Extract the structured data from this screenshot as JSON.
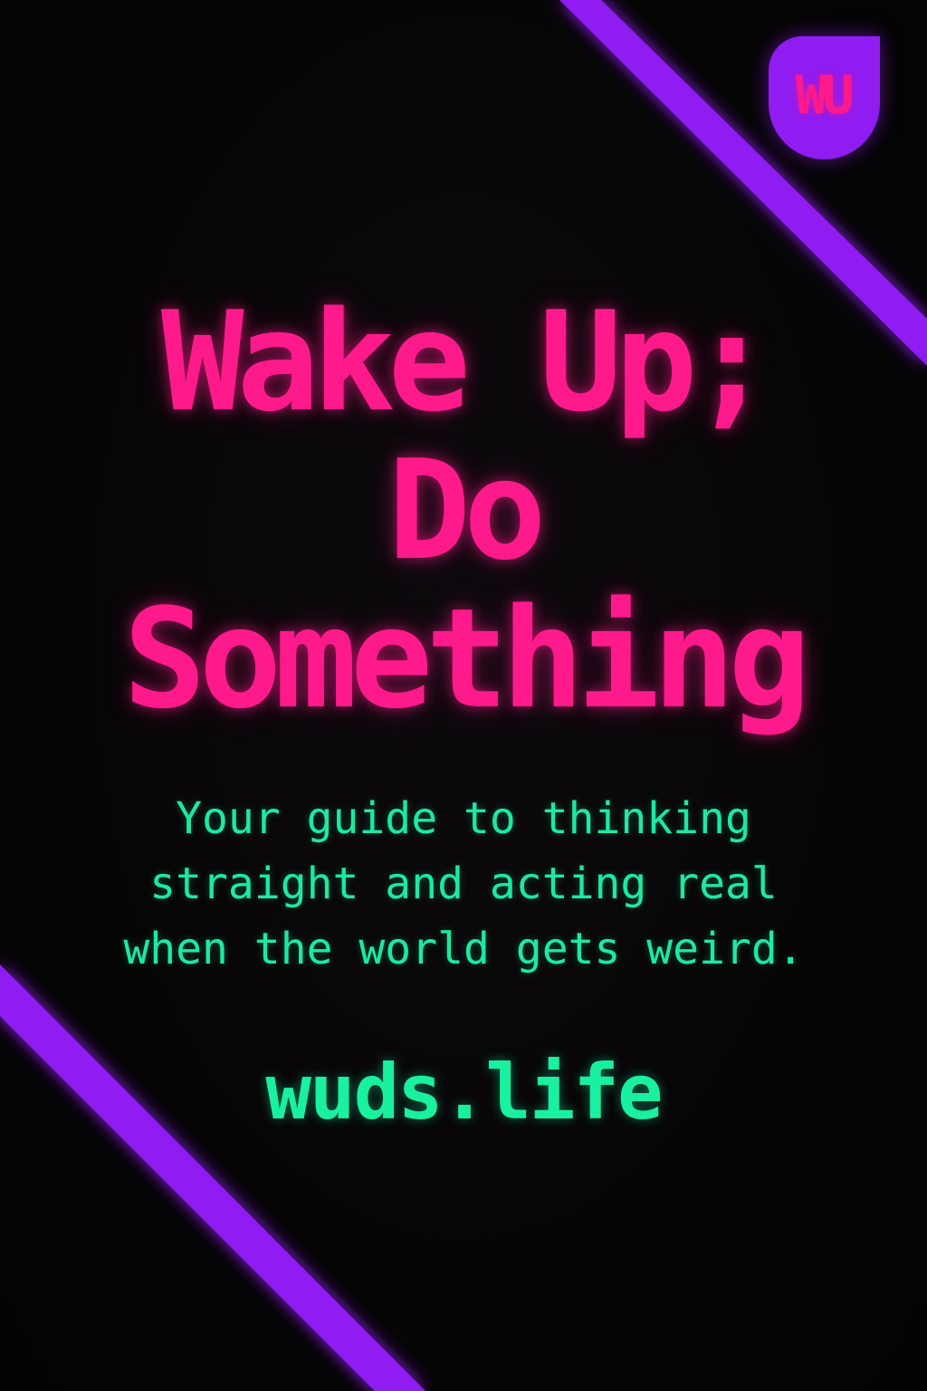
{
  "logo": {
    "text": "WU",
    "background_color": "#8f1cf0",
    "text_color": "#ff1a8c"
  },
  "title": {
    "lines": [
      "Wake Up;",
      "Do",
      "Something"
    ],
    "color": "#ff1a8c"
  },
  "subtitle": {
    "lines": [
      "Your guide to thinking",
      "straight and acting real",
      "when the world gets weird."
    ],
    "color": "#1de9a3"
  },
  "url": {
    "text": "wuds.life",
    "color": "#19f0a0"
  },
  "decor": {
    "stripe_color": "#8f1cf0",
    "background_color": "#050505"
  }
}
